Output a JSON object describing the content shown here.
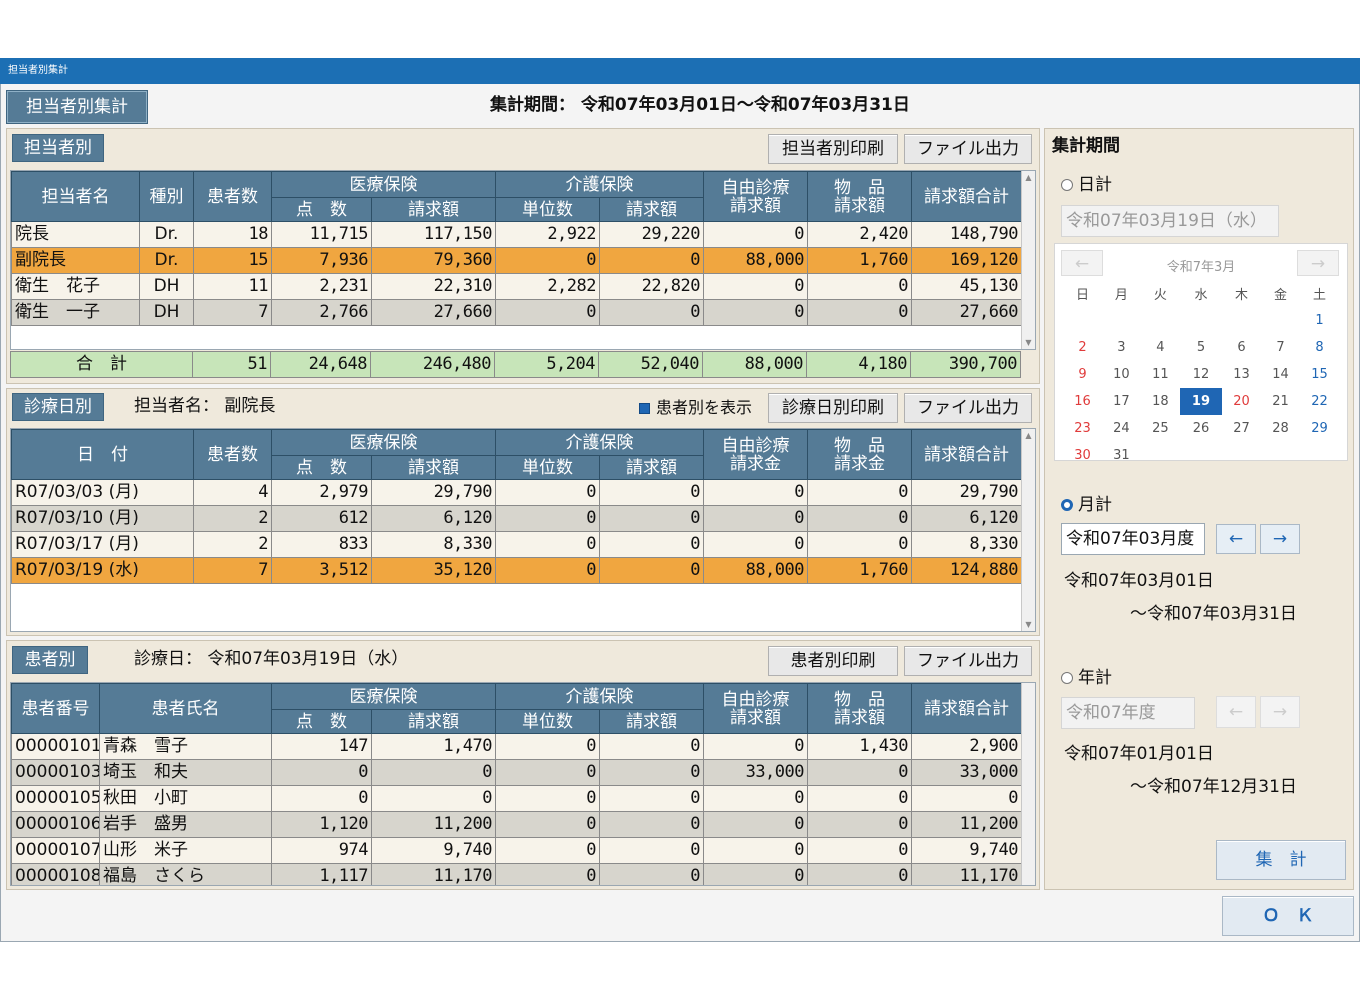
{
  "window_title": "担当者別集計",
  "screen_tab": "担当者別集計",
  "period_label": "集計期間：",
  "period_value": "令和07年03月01日～令和07年03月31日",
  "staff": {
    "tab": "担当者別",
    "print_button": "担当者別印刷",
    "file_button": "ファイル出力",
    "headers": {
      "name": "担当者名",
      "type": "種別",
      "patients": "患者数",
      "medical": "医療保険",
      "points": "点　数",
      "claim": "請求額",
      "care": "介護保険",
      "units": "単位数",
      "care_claim": "請求額",
      "free": "自由診療\n請求額",
      "goods": "物　品\n請求額",
      "total": "請求額合計"
    },
    "rows": [
      {
        "name": "院長",
        "type": "Dr.",
        "patients": "18",
        "points": "11,715",
        "claim": "117,150",
        "units": "2,922",
        "care_claim": "29,220",
        "free": "0",
        "goods": "2,420",
        "total": "148,790",
        "style": "odd"
      },
      {
        "name": "副院長",
        "type": "Dr.",
        "patients": "15",
        "points": "7,936",
        "claim": "79,360",
        "units": "0",
        "care_claim": "0",
        "free": "88,000",
        "goods": "1,760",
        "total": "169,120",
        "style": "sel"
      },
      {
        "name": "衛生　花子",
        "type": "DH",
        "patients": "11",
        "points": "2,231",
        "claim": "22,310",
        "units": "2,282",
        "care_claim": "22,820",
        "free": "0",
        "goods": "0",
        "total": "45,130",
        "style": "odd"
      },
      {
        "name": "衛生　一子",
        "type": "DH",
        "patients": "7",
        "points": "2,766",
        "claim": "27,660",
        "units": "0",
        "care_claim": "0",
        "free": "0",
        "goods": "0",
        "total": "27,660",
        "style": "even"
      }
    ],
    "total": {
      "label": "合　計",
      "patients": "51",
      "points": "24,648",
      "claim": "246,480",
      "units": "5,204",
      "care_claim": "52,040",
      "free": "88,000",
      "goods": "4,180",
      "total": "390,700"
    }
  },
  "daily": {
    "tab": "診療日別",
    "staff_label": "担当者名：",
    "staff_value": "副院長",
    "show_patients": "患者別を表示",
    "print_button": "診療日別印刷",
    "file_button": "ファイル出力",
    "headers": {
      "date": "日　付",
      "patients": "患者数",
      "medical": "医療保険",
      "points": "点　数",
      "claim": "請求額",
      "care": "介護保険",
      "units": "単位数",
      "care_claim": "請求額",
      "free": "自由診療\n請求金",
      "goods": "物　品\n請求金",
      "total": "請求額合計"
    },
    "rows": [
      {
        "date": "R07/03/03 (月)",
        "patients": "4",
        "points": "2,979",
        "claim": "29,790",
        "units": "0",
        "care_claim": "0",
        "free": "0",
        "goods": "0",
        "total": "29,790",
        "style": "odd"
      },
      {
        "date": "R07/03/10 (月)",
        "patients": "2",
        "points": "612",
        "claim": "6,120",
        "units": "0",
        "care_claim": "0",
        "free": "0",
        "goods": "0",
        "total": "6,120",
        "style": "even"
      },
      {
        "date": "R07/03/17 (月)",
        "patients": "2",
        "points": "833",
        "claim": "8,330",
        "units": "0",
        "care_claim": "0",
        "free": "0",
        "goods": "0",
        "total": "8,330",
        "style": "odd"
      },
      {
        "date": "R07/03/19 (水)",
        "patients": "7",
        "points": "3,512",
        "claim": "35,120",
        "units": "0",
        "care_claim": "0",
        "free": "88,000",
        "goods": "1,760",
        "total": "124,880",
        "style": "sel"
      }
    ]
  },
  "patients": {
    "tab": "患者別",
    "date_label": "診療日：",
    "date_value": "令和07年03月19日（水）",
    "print_button": "患者別印刷",
    "file_button": "ファイル出力",
    "headers": {
      "id": "患者番号",
      "name": "患者氏名",
      "medical": "医療保険",
      "points": "点　数",
      "claim": "請求額",
      "care": "介護保険",
      "units": "単位数",
      "care_claim": "請求額",
      "free": "自由診療\n請求額",
      "goods": "物　品\n請求額",
      "total": "請求額合計"
    },
    "rows": [
      {
        "id": "00000101",
        "name": "青森　雪子",
        "points": "147",
        "claim": "1,470",
        "units": "0",
        "care_claim": "0",
        "free": "0",
        "goods": "1,430",
        "total": "2,900",
        "style": "odd"
      },
      {
        "id": "00000103",
        "name": "埼玉　和夫",
        "points": "0",
        "claim": "0",
        "units": "0",
        "care_claim": "0",
        "free": "33,000",
        "goods": "0",
        "total": "33,000",
        "style": "even"
      },
      {
        "id": "00000105",
        "name": "秋田　小町",
        "points": "0",
        "claim": "0",
        "units": "0",
        "care_claim": "0",
        "free": "0",
        "goods": "0",
        "total": "0",
        "style": "odd"
      },
      {
        "id": "00000106",
        "name": "岩手　盛男",
        "points": "1,120",
        "claim": "11,200",
        "units": "0",
        "care_claim": "0",
        "free": "0",
        "goods": "0",
        "total": "11,200",
        "style": "even"
      },
      {
        "id": "00000107",
        "name": "山形　米子",
        "points": "974",
        "claim": "9,740",
        "units": "0",
        "care_claim": "0",
        "free": "0",
        "goods": "0",
        "total": "9,740",
        "style": "odd"
      },
      {
        "id": "00000108",
        "name": "福島　さくら",
        "points": "1,117",
        "claim": "11,170",
        "units": "0",
        "care_claim": "0",
        "free": "0",
        "goods": "0",
        "total": "11,170",
        "style": "even"
      }
    ]
  },
  "side": {
    "title": "集計期間",
    "daily_label": "日計",
    "daily_value": "令和07年03月19日（水）",
    "calendar": {
      "title": "令和7年3月",
      "prev": "←",
      "next": "→",
      "weekdays": [
        "日",
        "月",
        "火",
        "水",
        "木",
        "金",
        "土"
      ],
      "weeks": [
        [
          "",
          "",
          "",
          "",
          "",
          "",
          "1"
        ],
        [
          "2",
          "3",
          "4",
          "5",
          "6",
          "7",
          "8"
        ],
        [
          "9",
          "10",
          "11",
          "12",
          "13",
          "14",
          "15"
        ],
        [
          "16",
          "17",
          "18",
          "19",
          "20",
          "21",
          "22"
        ],
        [
          "23",
          "24",
          "25",
          "26",
          "27",
          "28",
          "29"
        ],
        [
          "30",
          "31",
          "",
          "",
          "",
          "",
          ""
        ]
      ],
      "holidays": [
        "20"
      ],
      "selected": "19"
    },
    "monthly_label": "月計",
    "monthly_value": "令和07年03月度",
    "monthly_from": "令和07年03月01日",
    "monthly_to": "～令和07年03月31日",
    "yearly_label": "年計",
    "yearly_value": "令和07年度",
    "yearly_from": "令和07年01月01日",
    "yearly_to": "～令和07年12月31日",
    "arrow_left": "←",
    "arrow_right": "→",
    "aggregate_button": "集　計"
  },
  "ok_button": "Ｏ　Ｋ"
}
